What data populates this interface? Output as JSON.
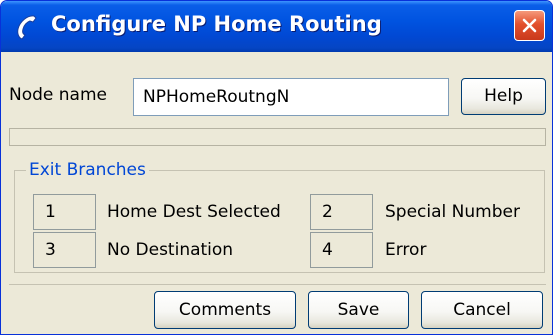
{
  "window": {
    "title": "Configure NP Home Routing",
    "icon": "telephone-handset-icon",
    "close_icon": "close-icon"
  },
  "node": {
    "label": "Node name",
    "value": "NPHomeRoutngN",
    "help_label": "Help"
  },
  "exit_branches": {
    "title": "Exit Branches",
    "items": [
      {
        "number": "1",
        "label": "Home Dest Selected"
      },
      {
        "number": "2",
        "label": "Special Number"
      },
      {
        "number": "3",
        "label": "No Destination"
      },
      {
        "number": "4",
        "label": "Error"
      }
    ]
  },
  "footer": {
    "comments_label": "Comments",
    "save_label": "Save",
    "cancel_label": "Cancel"
  },
  "colors": {
    "titlebar": "#0053e0",
    "window_bg": "#ece9d8",
    "group_title": "#0046d5",
    "close_button": "#e3512e"
  }
}
